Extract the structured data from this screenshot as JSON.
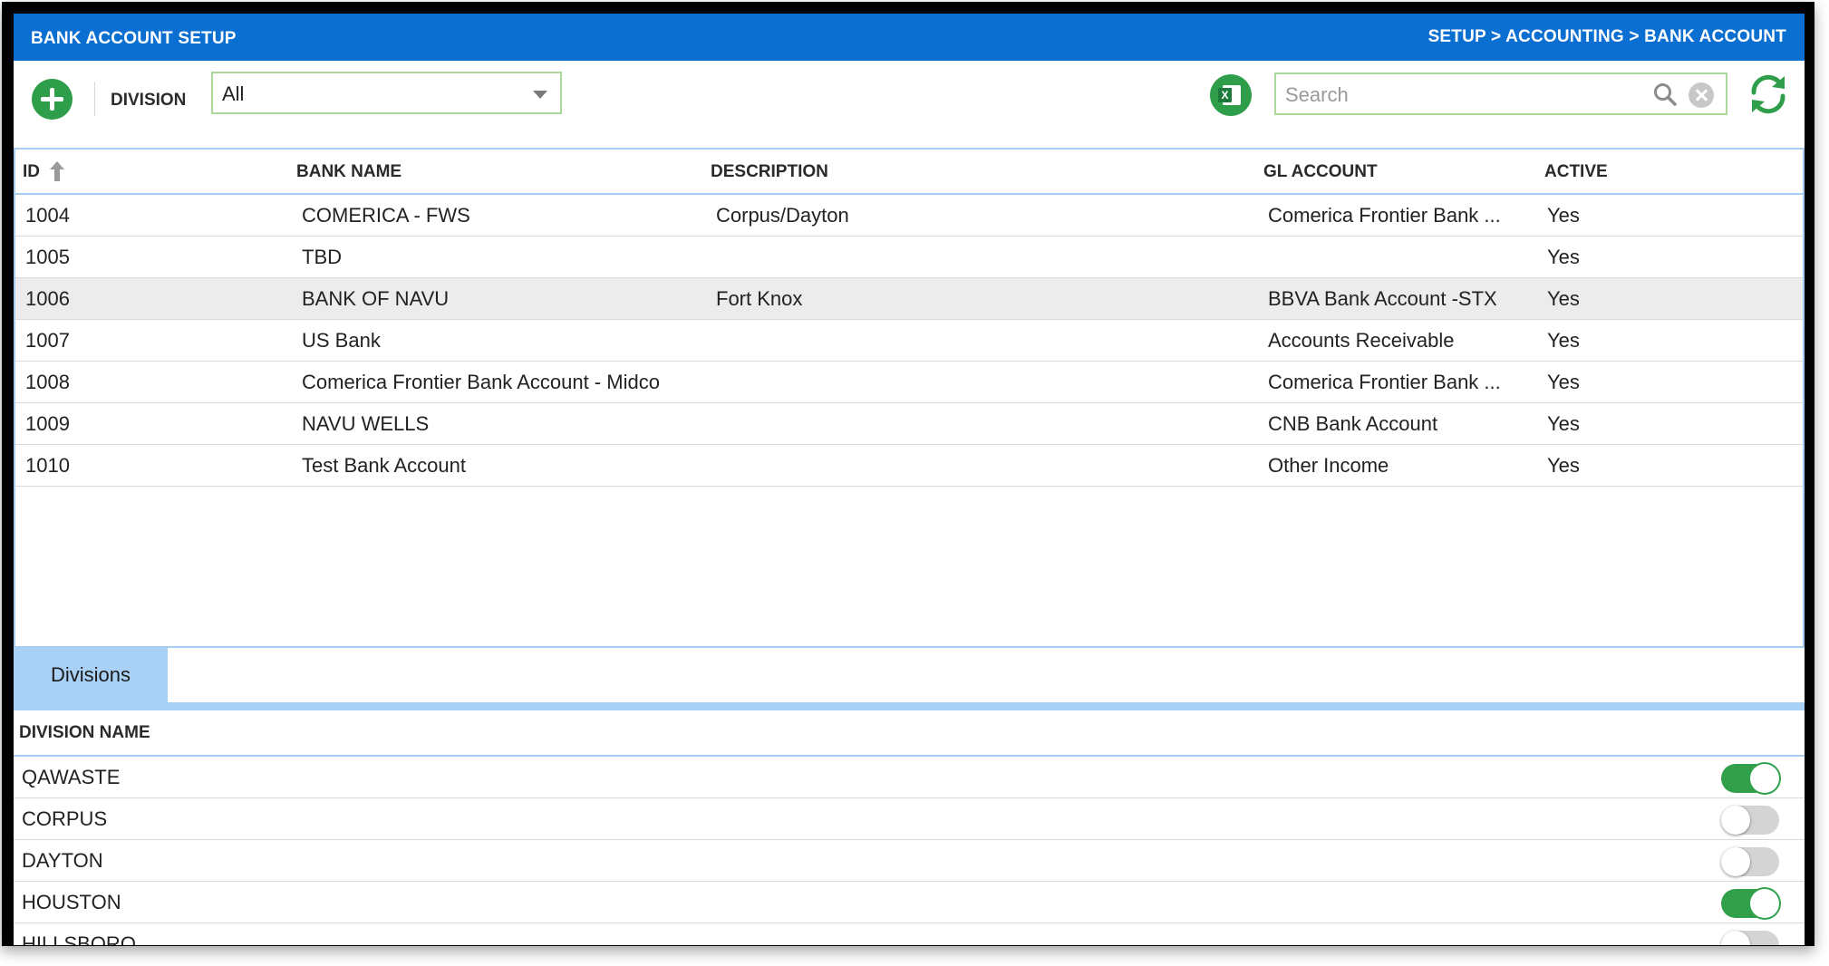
{
  "header": {
    "title": "BANK ACCOUNT SETUP",
    "breadcrumb": "SETUP > ACCOUNTING > BANK ACCOUNT"
  },
  "toolbar": {
    "division_label": "DIVISION",
    "division_value": "All",
    "search_placeholder": "Search"
  },
  "grid": {
    "columns": {
      "id": "ID",
      "bank_name": "BANK NAME",
      "description": "DESCRIPTION",
      "gl_account": "GL ACCOUNT",
      "active": "ACTIVE"
    },
    "rows": [
      {
        "id": "1004",
        "bank_name": "COMERICA - FWS",
        "description": "Corpus/Dayton",
        "gl_account": "Comerica Frontier Bank ...",
        "active": "Yes"
      },
      {
        "id": "1005",
        "bank_name": "TBD",
        "description": "",
        "gl_account": "",
        "active": "Yes"
      },
      {
        "id": "1006",
        "bank_name": "BANK OF NAVU",
        "description": "Fort Knox",
        "gl_account": "BBVA Bank Account -STX",
        "active": "Yes"
      },
      {
        "id": "1007",
        "bank_name": "US Bank",
        "description": "",
        "gl_account": "Accounts Receivable",
        "active": "Yes"
      },
      {
        "id": "1008",
        "bank_name": "Comerica Frontier Bank Account - Midco",
        "description": "",
        "gl_account": "Comerica Frontier Bank ...",
        "active": "Yes"
      },
      {
        "id": "1009",
        "bank_name": "NAVU WELLS",
        "description": "",
        "gl_account": "CNB Bank Account",
        "active": "Yes"
      },
      {
        "id": "1010",
        "bank_name": "Test Bank Account",
        "description": "",
        "gl_account": "Other Income",
        "active": "Yes"
      }
    ]
  },
  "tabs": [
    {
      "label": "Divisions"
    }
  ],
  "divisions": {
    "column": "DIVISION NAME",
    "rows": [
      {
        "name": "QAWASTE",
        "enabled": true
      },
      {
        "name": "CORPUS",
        "enabled": false
      },
      {
        "name": "DAYTON",
        "enabled": false
      },
      {
        "name": "HOUSTON",
        "enabled": true
      },
      {
        "name": "HILLSBORO",
        "enabled": false
      }
    ]
  },
  "colors": {
    "header_bg": "#0a6fd1",
    "accent_green": "#2f9e4a",
    "tab_bg": "#a9d0f5",
    "selected_row": "#ececec"
  }
}
